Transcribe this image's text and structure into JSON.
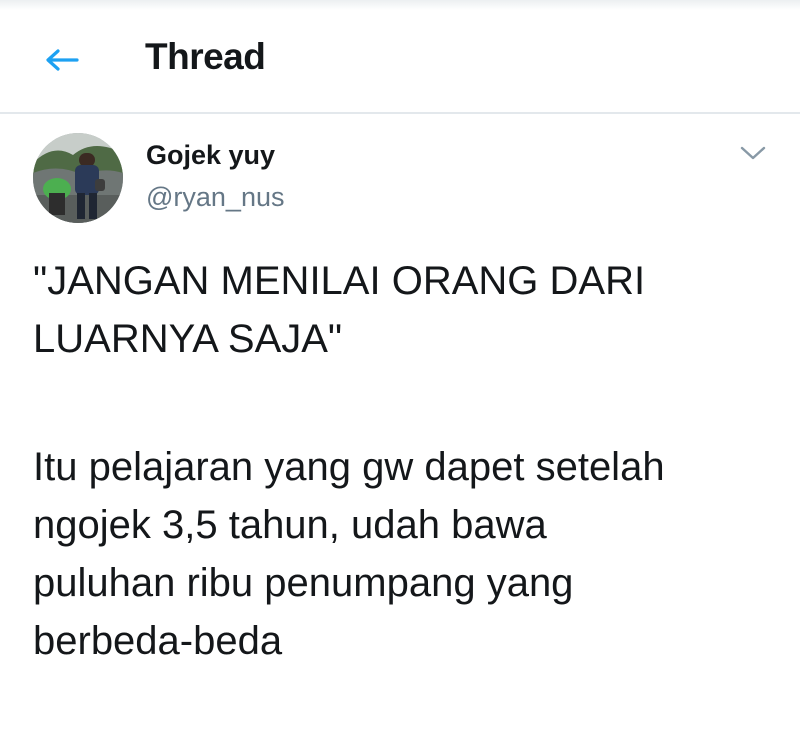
{
  "header": {
    "back_icon": "arrow-left-icon",
    "title": "Thread",
    "accent_color": "#1da1f2"
  },
  "tweet": {
    "author": {
      "display_name": "Gojek yuy",
      "handle": "@ryan_nus",
      "avatar_icon": "profile-photo"
    },
    "more_icon": "chevron-down-icon",
    "body_lines": [
      "\"JANGAN MENILAI ORANG DARI",
      "LUARNYA SAJA\"",
      "",
      "Itu pelajaran yang gw dapet setelah",
      "ngojek 3,5 tahun, udah bawa",
      "puluhan ribu penumpang yang",
      "berbeda-beda"
    ]
  }
}
